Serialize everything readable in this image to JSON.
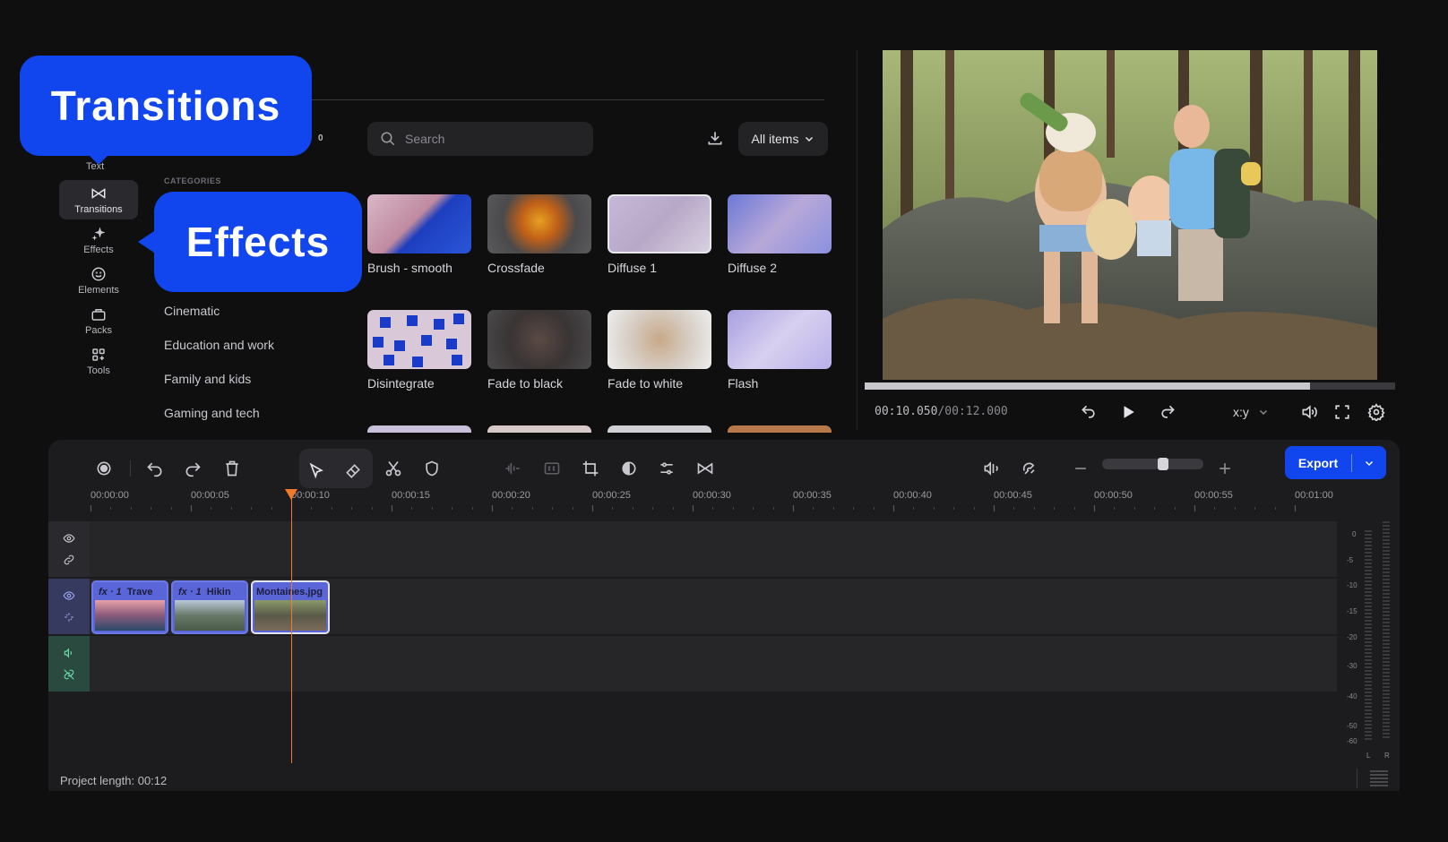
{
  "callouts": {
    "transitions": "Transitions",
    "effects": "Effects"
  },
  "nav": {
    "text_label": "Text",
    "items": [
      {
        "label": "Transitions",
        "icon": "transitions-icon"
      },
      {
        "label": "Effects",
        "icon": "sparkle-icon"
      },
      {
        "label": "Elements",
        "icon": "smiley-icon"
      },
      {
        "label": "Packs",
        "icon": "packs-icon"
      },
      {
        "label": "Tools",
        "icon": "tools-icon"
      }
    ]
  },
  "tab_count": "0",
  "categories": {
    "heading": "CATEGORIES",
    "items": [
      "Cinematic",
      "Education and work",
      "Family and kids",
      "Gaming and tech"
    ]
  },
  "search": {
    "placeholder": "Search"
  },
  "filter": {
    "label": "All items"
  },
  "transitions_grid": [
    "Brush - smooth",
    "Crossfade",
    "Diffuse 1",
    "Diffuse 2",
    "Disintegrate",
    "Fade to black",
    "Fade to white",
    "Flash"
  ],
  "player": {
    "timecode_current": "00:10.050",
    "timecode_total": "/00:12.000",
    "aspect_label": "x:y",
    "progress": 0.84
  },
  "timeline": {
    "export_label": "Export",
    "ruler": [
      "00:00:00",
      "00:00:05",
      "00:00:10",
      "00:00:15",
      "00:00:20",
      "00:00:25",
      "00:00:30",
      "00:00:35",
      "00:00:40",
      "00:00:45",
      "00:00:50",
      "00:00:55",
      "00:01:00"
    ],
    "clips": [
      {
        "fx": "fx · 1",
        "name": "Trave"
      },
      {
        "fx": "fx · 1",
        "name": "Hikin"
      },
      {
        "fx": "",
        "name": "Montaines.jpg"
      }
    ],
    "meter_scale": [
      "0",
      "-5",
      "-10",
      "-15",
      "-20",
      "-30",
      "-40",
      "-50",
      "-60"
    ],
    "meter_channels": [
      "L",
      "R"
    ],
    "project_length": "Project length: 00:12"
  },
  "colors": {
    "accent": "#1146ee",
    "playhead": "#f07a2a",
    "clip": "#5a66d8"
  }
}
